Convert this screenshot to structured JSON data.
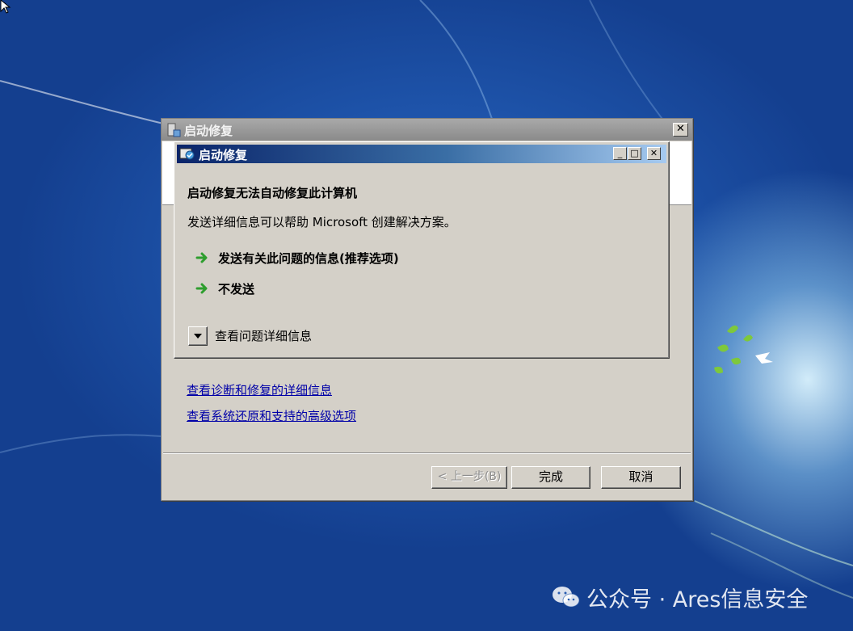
{
  "outer_window": {
    "title": "启动修复",
    "close_glyph": "✕",
    "links": [
      "查看诊断和修复的详细信息",
      "查看系统还原和支持的高级选项"
    ],
    "buttons": {
      "back": "< 上一步(B)",
      "finish": "完成",
      "cancel": "取消"
    }
  },
  "dialog": {
    "title": "启动修复",
    "heading": "启动修复无法自动修复此计算机",
    "description": "发送详细信息可以帮助 Microsoft 创建解决方案。",
    "options": [
      {
        "label": "发送有关此问题的信息(推荐选项)",
        "icon": "green-arrow-icon"
      },
      {
        "label": "不发送",
        "icon": "green-arrow-icon"
      }
    ],
    "details_toggle": "查看问题详细信息",
    "titlebar_glyphs": {
      "minimize": "_",
      "maximize": "□",
      "close": "✕"
    }
  },
  "watermark": {
    "text": "公众号 · Ares信息安全",
    "icon": "wechat-icon"
  },
  "colors": {
    "desktop_blue": "#1f56ad",
    "dialog_face": "#d4d0c8",
    "title_active": "#0a246a",
    "link": "#0000a8",
    "arrow_green": "#2e9e2e"
  }
}
